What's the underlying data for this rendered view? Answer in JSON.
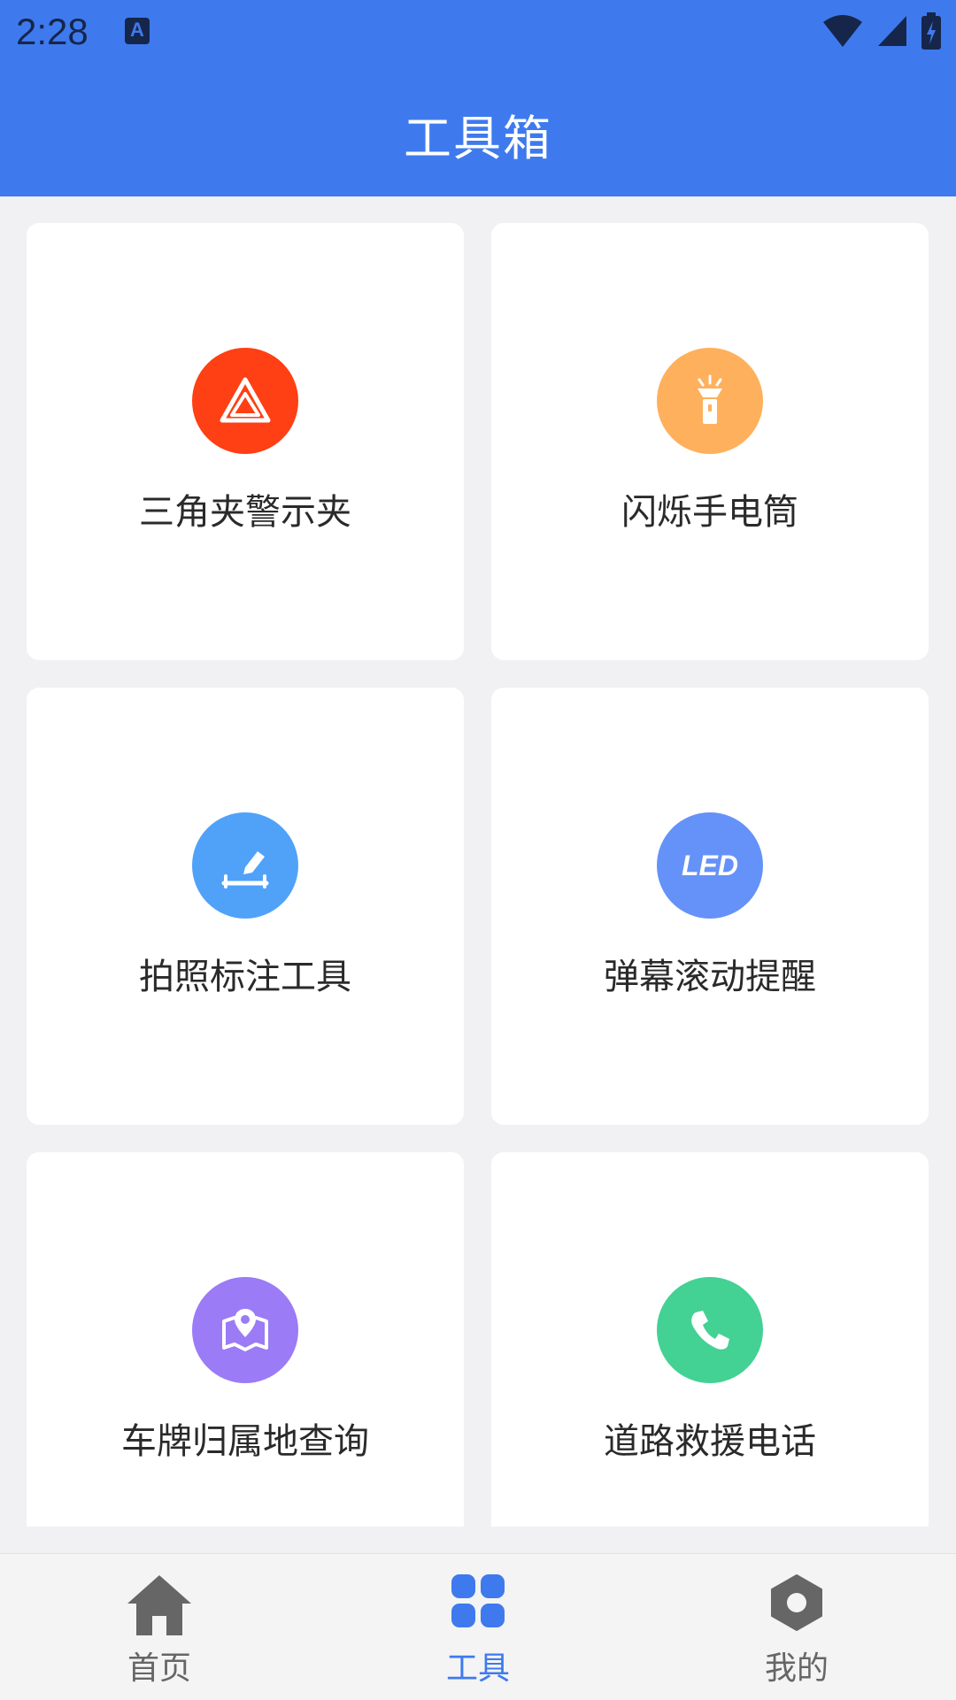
{
  "status_bar": {
    "time": "2:28",
    "notification_icon": "A"
  },
  "header": {
    "title": "工具箱"
  },
  "tools": [
    {
      "label": "三角夹警示夹",
      "icon": "warning-triangle-icon",
      "color": "#ff3f14"
    },
    {
      "label": "闪烁手电筒",
      "icon": "flashlight-icon",
      "color": "#ffb05c"
    },
    {
      "label": "拍照标注工具",
      "icon": "edit-annotation-icon",
      "color": "#50a2f9"
    },
    {
      "label": "弹幕滚动提醒",
      "icon": "led-icon",
      "icon_text": "LED",
      "color": "#6592f8"
    },
    {
      "label": "车牌归属地查询",
      "icon": "map-location-icon",
      "color": "#9b7bf6"
    },
    {
      "label": "道路救援电话",
      "icon": "phone-icon",
      "color": "#43d194"
    }
  ],
  "bottom_nav": {
    "items": [
      {
        "label": "首页",
        "icon": "home-icon",
        "color": "#666666",
        "active": false
      },
      {
        "label": "工具",
        "icon": "grid-icon",
        "color": "#3e7aee",
        "active": true
      },
      {
        "label": "我的",
        "icon": "hexagon-icon",
        "color": "#666666",
        "active": false
      }
    ]
  }
}
